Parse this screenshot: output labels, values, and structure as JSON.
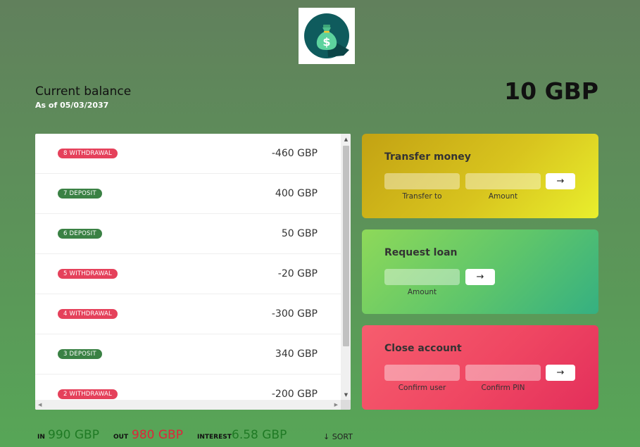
{
  "balance": {
    "title": "Current balance",
    "date_label": "As of 05/03/2037",
    "value": "10 GBP"
  },
  "movements": [
    {
      "type": "withdrawal",
      "badge": "8 WITHDRAWAL",
      "amount": "-460 GBP"
    },
    {
      "type": "deposit",
      "badge": "7 DEPOSIT",
      "amount": "400 GBP"
    },
    {
      "type": "deposit",
      "badge": "6 DEPOSIT",
      "amount": "50 GBP"
    },
    {
      "type": "withdrawal",
      "badge": "5 WITHDRAWAL",
      "amount": "-20 GBP"
    },
    {
      "type": "withdrawal",
      "badge": "4 WITHDRAWAL",
      "amount": "-300 GBP"
    },
    {
      "type": "deposit",
      "badge": "3 DEPOSIT",
      "amount": "340 GBP"
    },
    {
      "type": "withdrawal",
      "badge": "2 WITHDRAWAL",
      "amount": "-200 GBP"
    }
  ],
  "operations": {
    "transfer": {
      "title": "Transfer money",
      "to_label": "Transfer to",
      "to_value": "",
      "amount_label": "Amount",
      "amount_value": "",
      "button": "→"
    },
    "loan": {
      "title": "Request loan",
      "amount_label": "Amount",
      "amount_value": "",
      "button": "→"
    },
    "close": {
      "title": "Close account",
      "user_label": "Confirm user",
      "user_value": "",
      "pin_label": "Confirm PIN",
      "pin_value": "",
      "button": "→"
    }
  },
  "summary": {
    "in_label": "In",
    "in_value": "990 GBP",
    "out_label": "Out",
    "out_value": "980 GBP",
    "interest_label": "Interest",
    "interest_value": "6.58 GBP",
    "sort_label": "↓ SORT"
  },
  "colors": {
    "deposit": "#3a8144",
    "withdrawal": "#e5415b",
    "in": "#1f7a24",
    "out": "#e0243a"
  },
  "icons": {
    "logo": "money-bag-icon"
  }
}
